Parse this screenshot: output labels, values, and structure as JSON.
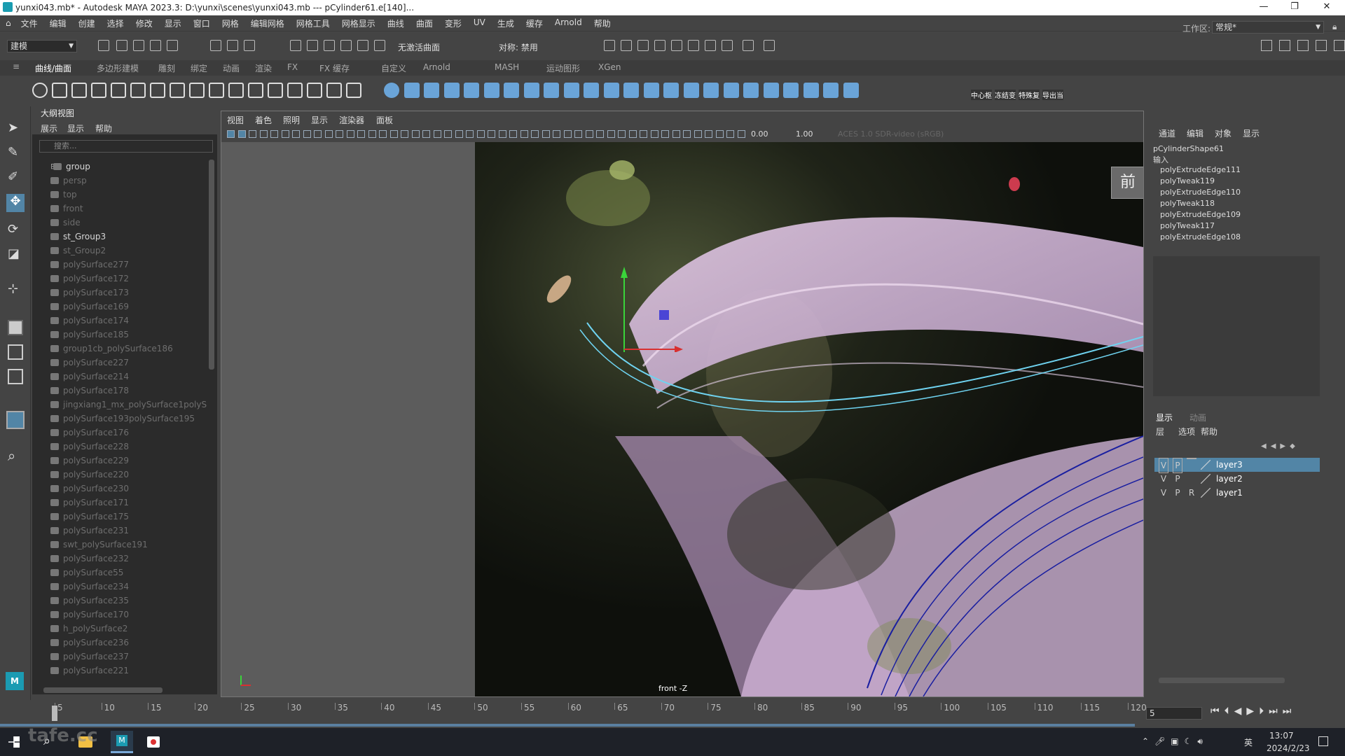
{
  "window": {
    "title": "yunxi043.mb* - Autodesk MAYA 2023.3: D:\\yunxi\\scenes\\yunxi043.mb   ---   pCylinder61.e[140]..."
  },
  "menubar": [
    "文件",
    "编辑",
    "创建",
    "选择",
    "修改",
    "显示",
    "窗口",
    "网格",
    "编辑网格",
    "网格工具",
    "网格显示",
    "曲线",
    "曲面",
    "变形",
    "UV",
    "生成",
    "缓存",
    "Arnold",
    "帮助"
  ],
  "toolbar": {
    "mode": "建模",
    "live_surface": "无激活曲面",
    "symmetry": "对称: 禁用",
    "workspace_label": "工作区:",
    "workspace_value": "常规*"
  },
  "shelf_tabs": [
    "曲线/曲面",
    "多边形建模",
    "雕刻",
    "绑定",
    "动画",
    "渲染",
    "FX",
    "FX 缓存",
    "自定义",
    "Arnold",
    "MASH",
    "运动图形",
    "XGen"
  ],
  "shelf_labels": [
    "中心枢",
    "冻结变",
    "特殊复",
    "导出当"
  ],
  "outliner": {
    "title": "大纲视图",
    "menu": [
      "展示",
      "显示",
      "帮助"
    ],
    "search_placeholder": "搜索...",
    "items": [
      {
        "label": "group",
        "dim": false,
        "indent": 1
      },
      {
        "label": "persp",
        "dim": true,
        "indent": 2
      },
      {
        "label": "top",
        "dim": true,
        "indent": 2
      },
      {
        "label": "front",
        "dim": true,
        "indent": 2
      },
      {
        "label": "side",
        "dim": true,
        "indent": 2
      },
      {
        "label": "st_Group3",
        "dim": false,
        "indent": 2
      },
      {
        "label": "st_Group2",
        "dim": true,
        "indent": 2
      },
      {
        "label": "polySurface277",
        "dim": true,
        "indent": 2
      },
      {
        "label": "polySurface172",
        "dim": true,
        "indent": 2
      },
      {
        "label": "polySurface173",
        "dim": true,
        "indent": 2
      },
      {
        "label": "polySurface169",
        "dim": true,
        "indent": 2
      },
      {
        "label": "polySurface174",
        "dim": true,
        "indent": 2
      },
      {
        "label": "polySurface185",
        "dim": true,
        "indent": 2
      },
      {
        "label": "group1cb_polySurface186",
        "dim": true,
        "indent": 2
      },
      {
        "label": "polySurface227",
        "dim": true,
        "indent": 2
      },
      {
        "label": "polySurface214",
        "dim": true,
        "indent": 2
      },
      {
        "label": "polySurface178",
        "dim": true,
        "indent": 2
      },
      {
        "label": "jingxiang1_mx_polySurface1polyS",
        "dim": true,
        "indent": 2
      },
      {
        "label": "polySurface193polySurface195",
        "dim": true,
        "indent": 2
      },
      {
        "label": "polySurface176",
        "dim": true,
        "indent": 2
      },
      {
        "label": "polySurface228",
        "dim": true,
        "indent": 2
      },
      {
        "label": "polySurface229",
        "dim": true,
        "indent": 2
      },
      {
        "label": "polySurface220",
        "dim": true,
        "indent": 2
      },
      {
        "label": "polySurface230",
        "dim": true,
        "indent": 2
      },
      {
        "label": "polySurface171",
        "dim": true,
        "indent": 2
      },
      {
        "label": "polySurface175",
        "dim": true,
        "indent": 2
      },
      {
        "label": "polySurface231",
        "dim": true,
        "indent": 2
      },
      {
        "label": "swt_polySurface191",
        "dim": true,
        "indent": 2
      },
      {
        "label": "polySurface232",
        "dim": true,
        "indent": 2
      },
      {
        "label": "polySurface55",
        "dim": true,
        "indent": 2
      },
      {
        "label": "polySurface234",
        "dim": true,
        "indent": 2
      },
      {
        "label": "polySurface235",
        "dim": true,
        "indent": 2
      },
      {
        "label": "polySurface170",
        "dim": true,
        "indent": 2
      },
      {
        "label": "h_polySurface2",
        "dim": true,
        "indent": 2
      },
      {
        "label": "polySurface236",
        "dim": true,
        "indent": 2
      },
      {
        "label": "polySurface237",
        "dim": true,
        "indent": 2
      },
      {
        "label": "polySurface221",
        "dim": true,
        "indent": 2
      }
    ]
  },
  "viewport": {
    "menu": [
      "视图",
      "着色",
      "照明",
      "显示",
      "渲染器",
      "面板"
    ],
    "value_a": "0.00",
    "value_b": "1.00",
    "colorspace": "ACES 1.0 SDR-video (sRGB)",
    "view_cube_label": "前",
    "camera_label": "front -Z"
  },
  "channelbox": {
    "menu": [
      "通道",
      "编辑",
      "对象",
      "显示"
    ],
    "shape": "pCylinderShape61",
    "inputs_label": "输入",
    "inputs": [
      "polyExtrudeEdge111",
      "polyTweak119",
      "polyExtrudeEdge110",
      "polyTweak118",
      "polyExtrudeEdge109",
      "polyTweak117",
      "polyExtrudeEdge108"
    ]
  },
  "layers": {
    "tabs": [
      "显示",
      "动画"
    ],
    "menu": [
      "层",
      "选项",
      "帮助"
    ],
    "rows": [
      {
        "v": "V",
        "p": "P",
        "r": "",
        "name": "layer3",
        "selected": true
      },
      {
        "v": "V",
        "p": "P",
        "r": "",
        "name": "layer2",
        "selected": false
      },
      {
        "v": "V",
        "p": "P",
        "r": "R",
        "name": "layer1",
        "selected": false
      }
    ]
  },
  "timeline": {
    "ticks": [
      "5",
      "10",
      "15",
      "20",
      "25",
      "30",
      "35",
      "40",
      "45",
      "50",
      "55",
      "60",
      "65",
      "70",
      "75",
      "80",
      "85",
      "90",
      "95",
      "100",
      "105",
      "110",
      "115",
      "120"
    ],
    "current_frame": "5"
  },
  "taskbar": {
    "time": "13:07",
    "date": "2024/2/23",
    "ime": "英",
    "watermark": "tafe.cc"
  }
}
